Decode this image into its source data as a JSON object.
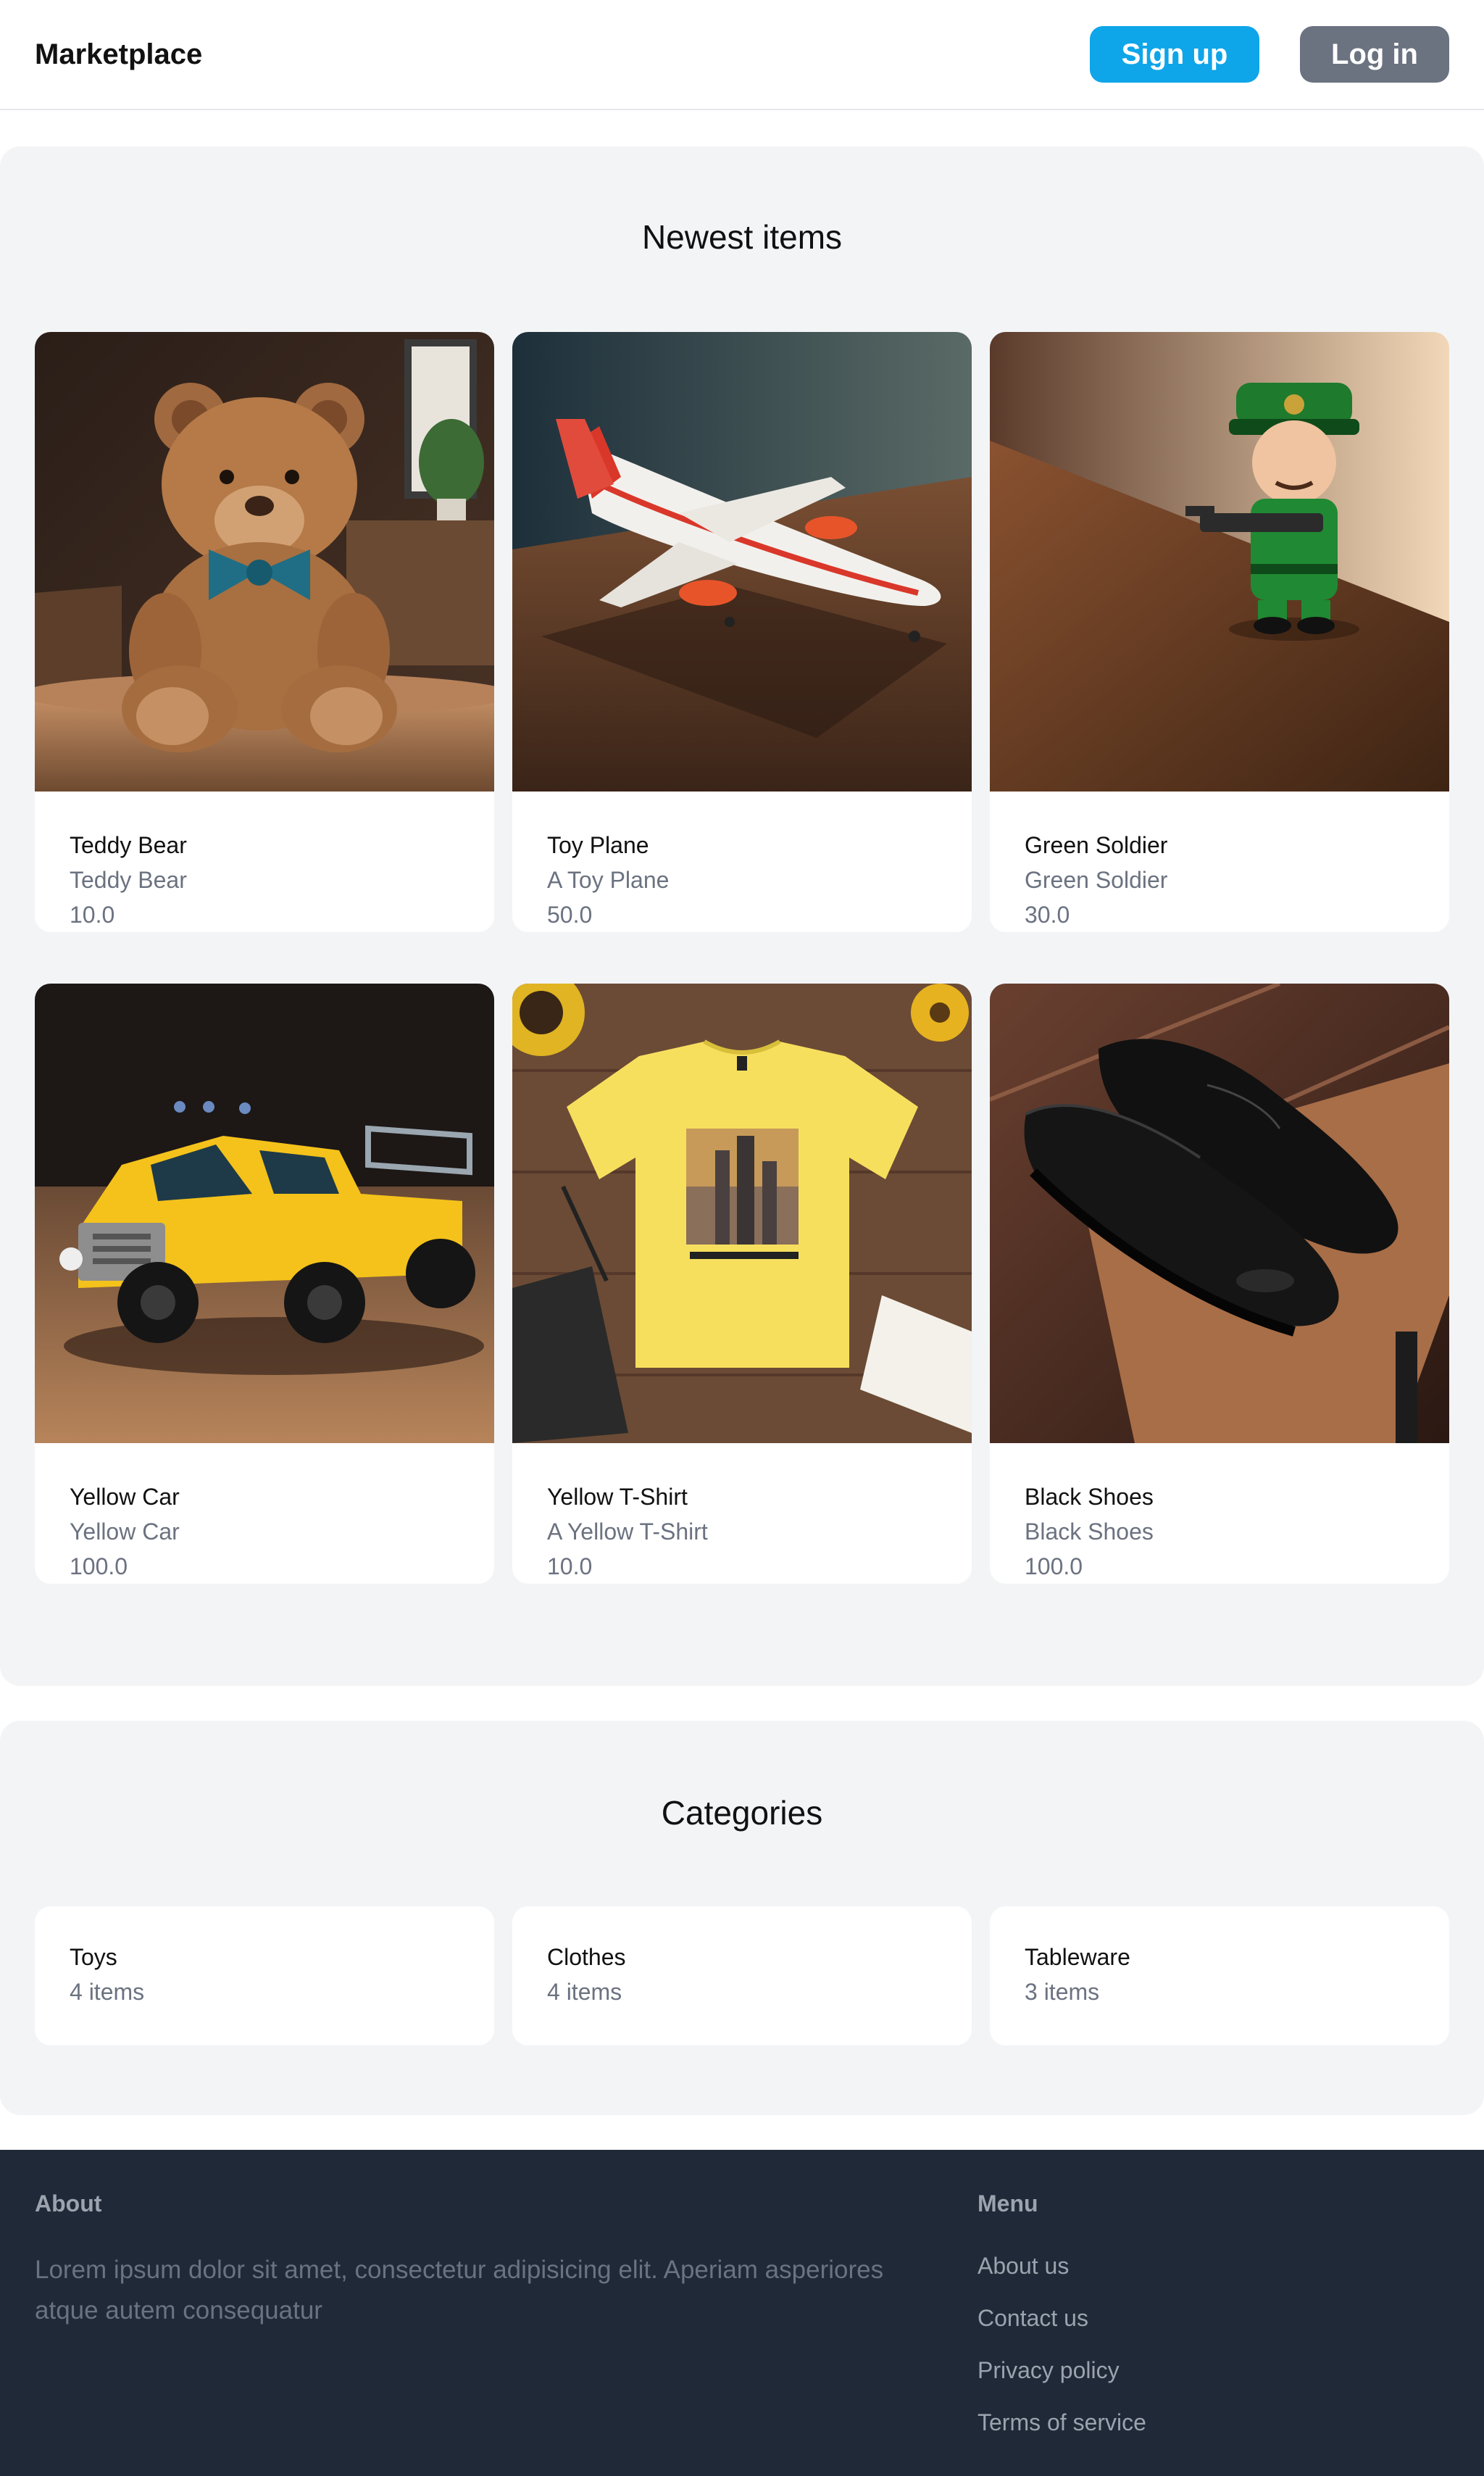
{
  "navbar": {
    "brand": "Marketplace",
    "signup_label": "Sign up",
    "login_label": "Log in",
    "signup_color": "#0ea5e9",
    "login_color": "#6b7280"
  },
  "newest": {
    "title": "Newest items",
    "items": [
      {
        "name": "Teddy Bear",
        "description": "Teddy Bear",
        "price": "10.0",
        "image": "teddy-bear-photo"
      },
      {
        "name": "Toy Plane",
        "description": "A Toy Plane",
        "price": "50.0",
        "image": "toy-plane-photo"
      },
      {
        "name": "Green Soldier",
        "description": "Green Soldier",
        "price": "30.0",
        "image": "green-soldier-photo"
      },
      {
        "name": "Yellow Car",
        "description": "Yellow Car",
        "price": "100.0",
        "image": "yellow-car-photo"
      },
      {
        "name": "Yellow T-Shirt",
        "description": "A Yellow T-Shirt",
        "price": "10.0",
        "image": "yellow-tshirt-photo"
      },
      {
        "name": "Black Shoes",
        "description": "Black Shoes",
        "price": "100.0",
        "image": "black-shoes-photo"
      }
    ]
  },
  "categories": {
    "title": "Categories",
    "items": [
      {
        "name": "Toys",
        "count": "4 items"
      },
      {
        "name": "Clothes",
        "count": "4 items"
      },
      {
        "name": "Tableware",
        "count": "3 items"
      }
    ]
  },
  "footer": {
    "about_title": "About",
    "about_text": "Lorem ipsum dolor sit amet, consectetur adipisicing elit. Aperiam asperiores atque autem consequatur",
    "menu_title": "Menu",
    "menu_links": [
      "About us",
      "Contact us",
      "Privacy policy",
      "Terms of service"
    ],
    "background_color": "#1f2937"
  }
}
